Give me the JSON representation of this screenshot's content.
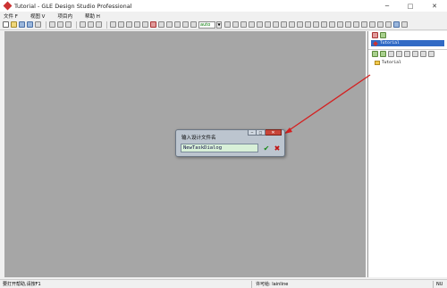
{
  "window": {
    "title": "Tutorial - GLE Design Studio Professional",
    "minimize_glyph": "─",
    "maximize_glyph": "□",
    "close_glyph": "✕"
  },
  "menu": {
    "items": [
      {
        "label": "文件 F"
      },
      {
        "label": "视图 V"
      },
      {
        "label": "项目内"
      },
      {
        "label": "帮助 H"
      }
    ]
  },
  "toolbar": {
    "zoom_value": "auto",
    "zoom_arrow": "▼"
  },
  "right_panel": {
    "tree": [
      {
        "label": "Tutorial",
        "selected": true
      }
    ],
    "files": [
      {
        "label": "Tutorial"
      }
    ]
  },
  "dialog": {
    "title": "输入设计文件名",
    "input_value": "NewTaskDialog",
    "ok_glyph": "✔",
    "cancel_glyph": "✖",
    "min_glyph": "─",
    "max_glyph": "□",
    "close_glyph": "✕"
  },
  "status": {
    "left": "要打开帮助,请按F1",
    "middle": "许可给: lainline",
    "right": "NU"
  },
  "colors": {
    "canvas": "#a6a6a6",
    "arrow": "#d42020",
    "selection": "#316ac5",
    "dialog_close": "#c84438"
  }
}
